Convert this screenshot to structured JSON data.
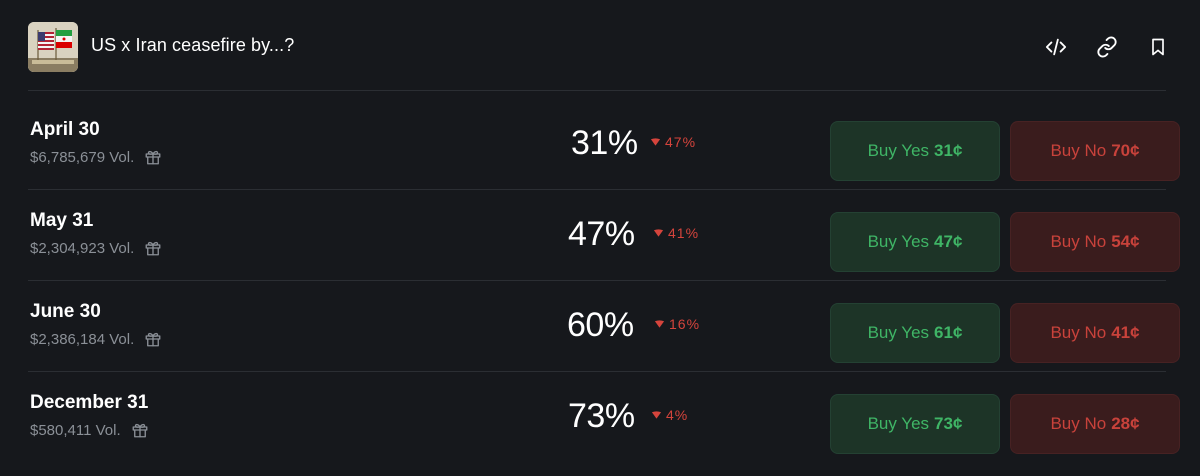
{
  "market": {
    "title": "US x Iran ceasefire by...?",
    "thumbnail_icon": "us-iran-flags-icon"
  },
  "header_actions": [
    {
      "name": "embed-code",
      "icon": "code-icon"
    },
    {
      "name": "copy-link",
      "icon": "link-icon"
    },
    {
      "name": "bookmark",
      "icon": "bookmark-icon"
    }
  ],
  "colors": {
    "background": "#16181c",
    "yes_bg": "#1d3427",
    "yes_text": "#3fb566",
    "no_bg": "#3a1c1d",
    "no_text": "#c8423b",
    "down": "#d5443c",
    "muted": "#8b9097"
  },
  "rows": [
    {
      "label": "April 30",
      "volume": "$6,785,679 Vol.",
      "chance": "31%",
      "change": "47%",
      "change_direction": "down",
      "yes_label": "Buy Yes",
      "yes_price": "31¢",
      "no_label": "Buy No",
      "no_price": "70¢"
    },
    {
      "label": "May 31",
      "volume": "$2,304,923 Vol.",
      "chance": "47%",
      "change": "41%",
      "change_direction": "down",
      "yes_label": "Buy Yes",
      "yes_price": "47¢",
      "no_label": "Buy No",
      "no_price": "54¢"
    },
    {
      "label": "June 30",
      "volume": "$2,386,184 Vol.",
      "chance": "60%",
      "change": "16%",
      "change_direction": "down",
      "yes_label": "Buy Yes",
      "yes_price": "61¢",
      "no_label": "Buy No",
      "no_price": "41¢"
    },
    {
      "label": "December 31",
      "volume": "$580,411 Vol.",
      "chance": "73%",
      "change": "4%",
      "change_direction": "down",
      "yes_label": "Buy Yes",
      "yes_price": "73¢",
      "no_label": "Buy No",
      "no_price": "28¢"
    }
  ]
}
